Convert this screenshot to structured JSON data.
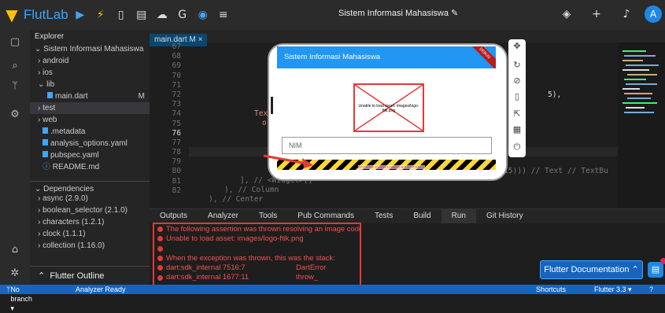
{
  "app": {
    "name": "FlutLab",
    "project_title": "Sistem Informasi Mahasiswa",
    "avatar_letter": "A",
    "accent": "#42a5f5"
  },
  "toolbar_icons": [
    "run-icon",
    "hot-reload-icon",
    "stop-icon",
    "save-icon",
    "cloud-icon",
    "google-icon",
    "firebase-icon",
    "menu-icon"
  ],
  "explorer": {
    "header": "Explorer",
    "root": "Sistem Informasi Mahasiswa",
    "items": [
      {
        "label": "android",
        "prefix": "›"
      },
      {
        "label": "ios",
        "prefix": "›"
      },
      {
        "label": "lib",
        "prefix": "⌄"
      },
      {
        "label": "main.dart",
        "marker": "M"
      },
      {
        "label": "test",
        "prefix": "›"
      },
      {
        "label": "web",
        "prefix": "›"
      },
      {
        "label": ".metadata"
      },
      {
        "label": "analysis_options.yaml"
      },
      {
        "label": "pubspec.yaml"
      },
      {
        "label": "README.md"
      }
    ],
    "dependencies_header": "Dependencies",
    "dependencies": [
      "async (2.9.0)",
      "boolean_selector (2.1.0)",
      "characters (1.2.1)",
      "clock (1.1.1)",
      "collection (1.16.0)"
    ],
    "outline_label": "Flutter Outline"
  },
  "editor": {
    "tab_label": "main.dart M ×",
    "line_numbers": [
      "67",
      "68",
      "69",
      "70",
      "71",
      "72",
      "73",
      "74",
      "75",
      "76",
      "77",
      "78",
      "79",
      "80",
      "81",
      "82"
    ],
    "current_line": "76",
    "code_fragments": {
      "l71": "5),",
      "l73": "TextB",
      "l74": "o",
      "l78": "15))) // Text // TextBu",
      "l79": "], // <Widget>[]",
      "l80": "), // Column",
      "l81": "), // Center"
    }
  },
  "panel": {
    "tabs": [
      "Outputs",
      "Analyzer",
      "Tools",
      "Pub Commands",
      "Tests",
      "Build",
      "Run",
      "Git History"
    ],
    "active_tab": "Run",
    "errors": [
      {
        "text": "The following assertion was thrown resolving an image codec:",
        "right": ""
      },
      {
        "text": "Unable to load asset: images/logo-ftik.png",
        "right": ""
      },
      {
        "text": "",
        "right": ""
      },
      {
        "text": "When the exception was thrown, this was the stack:",
        "right": ""
      },
      {
        "text": "dart:sdk_internal 7516:7",
        "right": "DartError"
      },
      {
        "text": "dart:sdk_internal 1677:11",
        "right": "throw_"
      }
    ],
    "doc_button": "Flutter Documentation ⌃",
    "chat_icon": "chat-icon"
  },
  "phone": {
    "appbar_title": "Sistem Informasi Mahasiswa",
    "debug_banner": "DEBUG",
    "image_error": "Unable to load asset: images/logo-ftik.png",
    "input_placeholder": "NIM",
    "overflow_label": "BOTTOM OVERFLOWED BY 47 PIXELS"
  },
  "statusbar": {
    "branch": "No branch ▾",
    "analyzer": "Analyzer Ready",
    "shortcuts": "Shortcuts",
    "flutter_version": "Flutter 3.3 ▾",
    "help": "?"
  }
}
